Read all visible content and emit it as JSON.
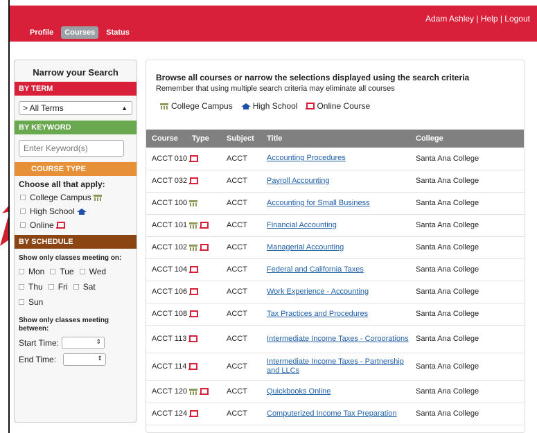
{
  "header": {
    "user_links": "Adam Ashley | Help | Logout",
    "nav": [
      {
        "label": "Profile",
        "active": false
      },
      {
        "label": "Courses",
        "active": true
      },
      {
        "label": "Status",
        "active": false
      }
    ]
  },
  "sidebar": {
    "title": "Narrow your Search",
    "by_term": "BY TERM",
    "term_value": "> All Terms",
    "by_keyword": "BY KEYWORD",
    "keyword_placeholder": "Enter Keyword(s)",
    "course_type": "COURSE TYPE",
    "choose_all": "Choose all that apply:",
    "type_options": [
      "College Campus",
      "High School",
      "Online"
    ],
    "by_schedule": "BY SCHEDULE",
    "show_meeting_on": "Show only classes meeting on:",
    "days": [
      "Mon",
      "Tue",
      "Wed",
      "Thu",
      "Fri",
      "Sat",
      "Sun"
    ],
    "show_meeting_between": "Show only classes meeting between:",
    "start_time": "Start Time:",
    "end_time": "End Time:"
  },
  "main": {
    "browse_text": "Browse all courses or narrow the selections displayed using the search criteria",
    "remember_text": "Remember that using multiple search criteria may eliminate all courses",
    "legend": [
      "College Campus",
      "High School",
      "Online Course"
    ],
    "columns": [
      "Course",
      "Type",
      "Subject",
      "Title",
      "College"
    ],
    "rows": [
      {
        "course": "ACCT 010",
        "types": [
          "online"
        ],
        "subject": "ACCT",
        "title": "Accounting Procedures",
        "college": "Santa Ana College"
      },
      {
        "course": "ACCT 032",
        "types": [
          "online"
        ],
        "subject": "ACCT",
        "title": "Payroll Accounting",
        "college": "Santa Ana College"
      },
      {
        "course": "ACCT 100",
        "types": [
          "campus"
        ],
        "subject": "ACCT",
        "title": "Accounting for Small Business",
        "college": "Santa Ana College"
      },
      {
        "course": "ACCT 101",
        "types": [
          "campus",
          "online"
        ],
        "subject": "ACCT",
        "title": "Financial Accounting",
        "college": "Santa Ana College"
      },
      {
        "course": "ACCT 102",
        "types": [
          "campus",
          "online"
        ],
        "subject": "ACCT",
        "title": "Managerial Accounting",
        "college": "Santa Ana College"
      },
      {
        "course": "ACCT 104",
        "types": [
          "online"
        ],
        "subject": "ACCT",
        "title": "Federal and California Taxes",
        "college": "Santa Ana College"
      },
      {
        "course": "ACCT 106",
        "types": [
          "online"
        ],
        "subject": "ACCT",
        "title": "Work Experience - Accounting",
        "college": "Santa Ana College"
      },
      {
        "course": "ACCT 108",
        "types": [
          "online"
        ],
        "subject": "ACCT",
        "title": "Tax Practices and Procedures",
        "college": "Santa Ana College"
      },
      {
        "course": "ACCT 113",
        "types": [
          "online"
        ],
        "subject": "ACCT",
        "title": "Intermediate Income Taxes - Corporations",
        "college": "Santa Ana College"
      },
      {
        "course": "ACCT 114",
        "types": [
          "online"
        ],
        "subject": "ACCT",
        "title": "Intermediate Income Taxes - Partnership and LLCs",
        "college": "Santa Ana College"
      },
      {
        "course": "ACCT 120",
        "types": [
          "campus",
          "online"
        ],
        "subject": "ACCT",
        "title": "Quickbooks Online",
        "college": "Santa Ana College"
      },
      {
        "course": "ACCT 124",
        "types": [
          "online"
        ],
        "subject": "ACCT",
        "title": "Computerized Income Tax Preparation",
        "college": "Santa Ana College"
      }
    ]
  },
  "colors": {
    "brand_red": "#d8203a",
    "keyword_green": "#6aa84f",
    "type_orange": "#e69138",
    "schedule_brown": "#8b4513",
    "table_header": "#808080",
    "link_blue": "#1f5fa8"
  }
}
